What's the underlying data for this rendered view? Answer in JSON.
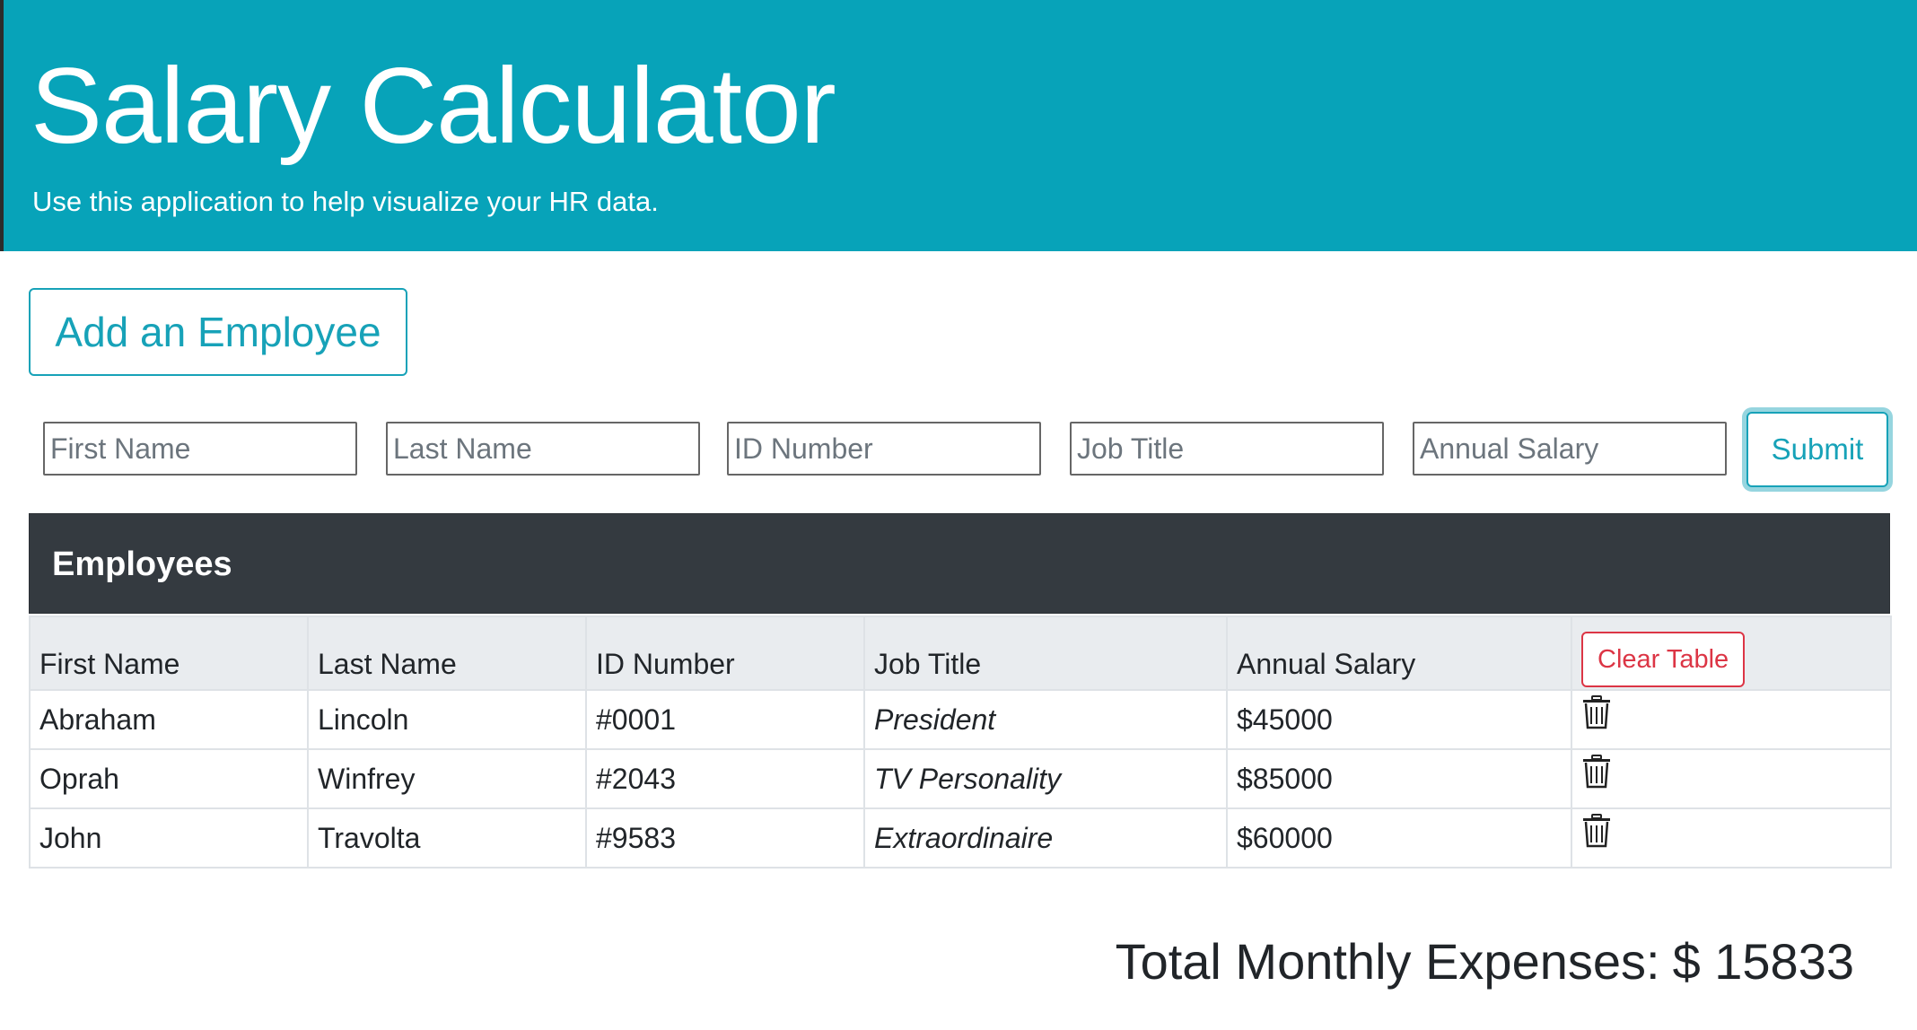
{
  "hero": {
    "title": "Salary Calculator",
    "subtitle": "Use this application to help visualize your HR data."
  },
  "form": {
    "add_button_label": "Add an Employee",
    "fields": {
      "first_name": {
        "placeholder": "First Name",
        "value": ""
      },
      "last_name": {
        "placeholder": "Last Name",
        "value": ""
      },
      "id_number": {
        "placeholder": "ID Number",
        "value": ""
      },
      "job_title": {
        "placeholder": "Job Title",
        "value": ""
      },
      "annual_salary": {
        "placeholder": "Annual Salary",
        "value": ""
      }
    },
    "submit_label": "Submit"
  },
  "table": {
    "title": "Employees",
    "columns": [
      "First Name",
      "Last Name",
      "ID Number",
      "Job Title",
      "Annual Salary"
    ],
    "clear_label": "Clear Table",
    "rows": [
      {
        "first": "Abraham",
        "last": "Lincoln",
        "id": "#0001",
        "title": "President",
        "salary": "$45000",
        "action_icon": "trash-icon"
      },
      {
        "first": "Oprah",
        "last": "Winfrey",
        "id": "#2043",
        "title": "TV Personality",
        "salary": "$85000",
        "action_icon": "trash-icon"
      },
      {
        "first": "John",
        "last": "Travolta",
        "id": "#9583",
        "title": "Extraordinaire",
        "salary": "$60000",
        "action_icon": "trash-icon"
      }
    ]
  },
  "total": {
    "label": "Total Monthly Expenses:",
    "amount": "$ 15833"
  },
  "colors": {
    "accent": "#17a2b8",
    "hero_bg": "#07a3b9",
    "table_header_bg": "#343a40",
    "danger": "#dc3545"
  }
}
